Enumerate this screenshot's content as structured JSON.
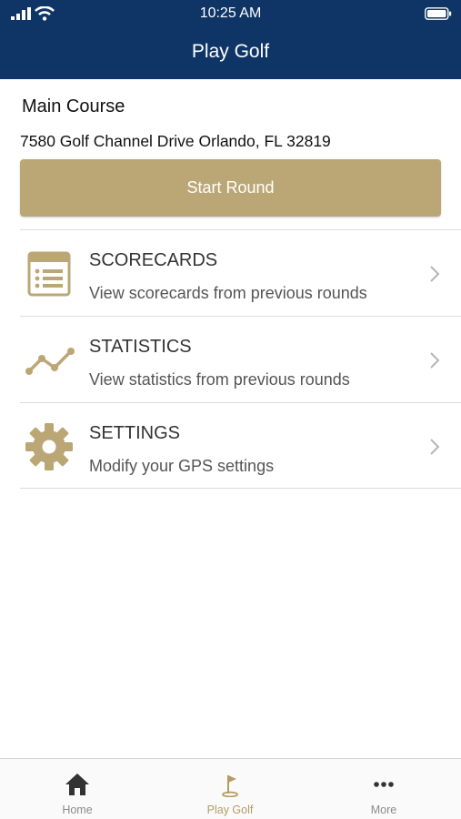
{
  "status_bar": {
    "time": "10:25 AM"
  },
  "header": {
    "title": "Play Golf"
  },
  "course": {
    "name": "Main Course",
    "address": "7580 Golf Channel Drive Orlando, FL 32819",
    "start_label": "Start Round"
  },
  "menu": [
    {
      "title": "SCORECARDS",
      "subtitle": "View scorecards from previous rounds",
      "icon": "scorecard-icon"
    },
    {
      "title": "STATISTICS",
      "subtitle": "View statistics from previous rounds",
      "icon": "statistics-icon"
    },
    {
      "title": "SETTINGS",
      "subtitle": "Modify your GPS settings",
      "icon": "gear-icon"
    }
  ],
  "tab_bar": {
    "items": [
      {
        "label": "Home",
        "icon": "home-icon"
      },
      {
        "label": "Play Golf",
        "icon": "golf-flag-icon",
        "active": true
      },
      {
        "label": "More",
        "icon": "more-icon"
      }
    ]
  },
  "colors": {
    "header_bg": "#0f3566",
    "accent_gold": "#bba776",
    "divider": "#dcdcdc"
  }
}
